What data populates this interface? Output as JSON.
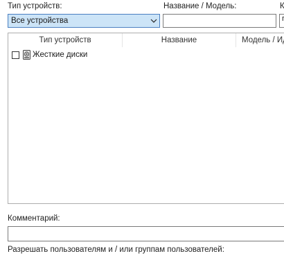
{
  "filters": {
    "device_type_label": "Тип устройств:",
    "device_type_value": "Все устройства",
    "name_model_label": "Название / Модель:",
    "third_label_partial": "К",
    "third_field_partial": "г"
  },
  "device_list": {
    "columns": [
      "Тип устройств",
      "Название",
      "Модель / Ид"
    ],
    "rows": [
      {
        "checked": false,
        "icon": "hard-disk-icon",
        "label": "Жесткие диски"
      }
    ]
  },
  "comment": {
    "label": "Комментарий:",
    "value": ""
  },
  "permissions": {
    "label": "Разрешать пользователям и / или группам пользователей:"
  }
}
